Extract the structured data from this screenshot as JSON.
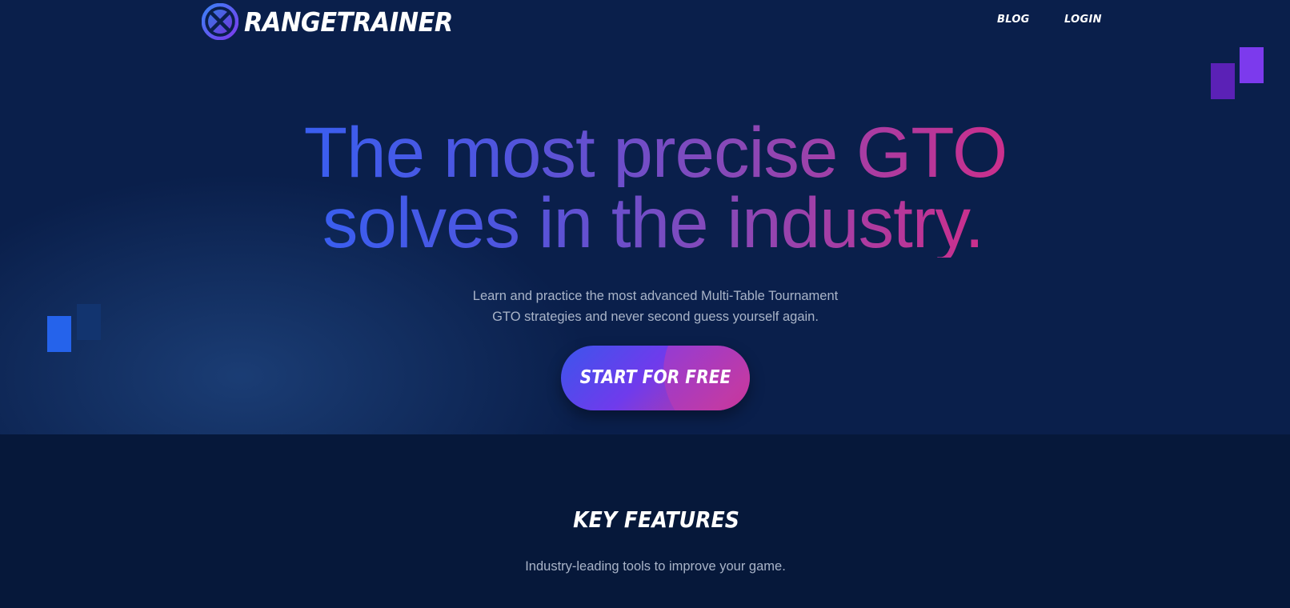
{
  "header": {
    "brand": "RANGETRAINER",
    "nav": [
      {
        "label": "BLOG"
      },
      {
        "label": "LOGIN"
      }
    ]
  },
  "hero": {
    "headline_line1": "The most precise GTO",
    "headline_line2": "solves in the industry.",
    "subtitle_line1": "Learn and practice the most advanced Multi-Table Tournament",
    "subtitle_line2": "GTO strategies and never second guess yourself again.",
    "cta_label": "START FOR FREE"
  },
  "features": {
    "title": "KEY FEATURES",
    "subtitle": "Industry-leading tools to improve your game."
  },
  "colors": {
    "hero_bg": "#0a1f4b",
    "features_bg": "#06183a",
    "gradient_start": "#3a5ef0",
    "gradient_end": "#cc2f8c"
  }
}
